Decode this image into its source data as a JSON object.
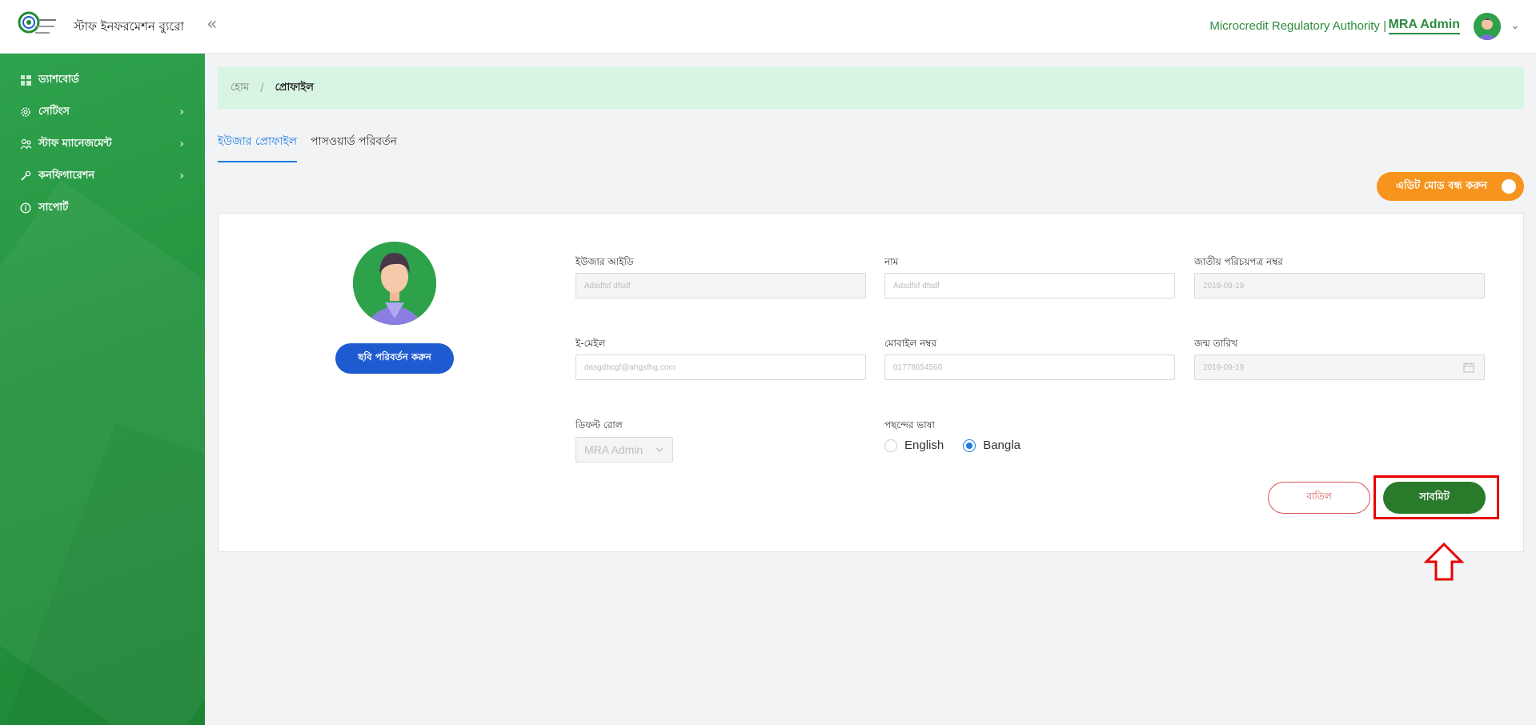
{
  "header": {
    "app_title": "স্টাফ ইনফরমেশন ব্যুরো",
    "logo_text": "Microcredit Regulatory Authority",
    "org_name": "Microcredit Regulatory Authority |",
    "user_name": "MRA Admin",
    "collapse_icon": "double-chevron-left-icon"
  },
  "sidebar": {
    "items": [
      {
        "label": "ড্যাশবোর্ড",
        "icon": "dashboard-icon",
        "has_children": false
      },
      {
        "label": "সেটিংস",
        "icon": "gear-icon",
        "has_children": true
      },
      {
        "label": "স্টাফ ম্যানেজমেন্ট",
        "icon": "staff-icon",
        "has_children": true
      },
      {
        "label": "কনফিগারেশন",
        "icon": "wrench-icon",
        "has_children": true
      },
      {
        "label": "সাপোর্ট",
        "icon": "info-icon",
        "has_children": false
      }
    ]
  },
  "breadcrumb": {
    "home": "হোম",
    "separator": "/",
    "current": "প্রোফাইল"
  },
  "tabs": {
    "user_profile": "ইউজার প্রোফাইল",
    "change_password": "পাসওয়ার্ড পরিবর্তন",
    "active": "user_profile"
  },
  "edit_toggle": {
    "label": "এডিট মোড বন্ধ করুন"
  },
  "profile": {
    "change_photo_label": "ছবি পরিবর্তন করুন",
    "fields": {
      "user_id": {
        "label": "ইউজার আইডি",
        "value": "Adsdfsf dfsdf"
      },
      "name": {
        "label": "নাম",
        "value": "Adsdfsf dfsdf"
      },
      "nid": {
        "label": "জাতীয় পরিচয়পত্র নম্বর",
        "value": "2019-09-19"
      },
      "email": {
        "label": "ই-মেইল",
        "value": "dasgdhcgf@ahgsfhg.com"
      },
      "mobile": {
        "label": "মোবাইল নম্বর",
        "value": "01778654566"
      },
      "dob": {
        "label": "জন্ম তারিখ",
        "value": "2019-09-19"
      }
    },
    "default_role": {
      "label": "ডিফল্ট রোল",
      "value": "MRA Admin"
    },
    "language": {
      "label": "পছন্দের ভাষা",
      "options": [
        "English",
        "Bangla"
      ],
      "selected": "Bangla"
    }
  },
  "actions": {
    "cancel_label": "বাতিল",
    "submit_label": "সাবমিট"
  },
  "colors": {
    "brand_green": "#2e8b3e",
    "accent_blue": "#1e7de0",
    "toggle_orange": "#f7941d",
    "submit_green": "#2a7a2c",
    "cancel_red": "#d9534f",
    "highlight_red": "#e60000"
  }
}
